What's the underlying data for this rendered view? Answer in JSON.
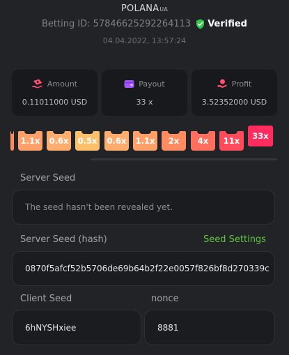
{
  "brand": {
    "name": "POLANA",
    "suffix": "UA"
  },
  "bet": {
    "id_label": "Betting ID:",
    "id_value": "57846625292264113",
    "verified_label": "Verified",
    "datetime": "04.04.2022, 13:57:24"
  },
  "stats": {
    "amount": {
      "label": "Amount",
      "value": "0.11011000 USD",
      "icon": "money-hand-icon"
    },
    "payout": {
      "label": "Payout",
      "value": "33 x",
      "icon": "wallet-icon"
    },
    "profit": {
      "label": "Profit",
      "value": "3.52352000 USD",
      "icon": "coin-hand-icon"
    }
  },
  "multipliers": [
    {
      "label": "",
      "color": "#ff8a5c"
    },
    {
      "label": "1.1x",
      "color": "#ff9f69"
    },
    {
      "label": "0.6x",
      "color": "#ffad6e"
    },
    {
      "label": "0.5x",
      "color": "#ffc06c"
    },
    {
      "label": "0.6x",
      "color": "#ffad6e"
    },
    {
      "label": "1.1x",
      "color": "#ff9f69"
    },
    {
      "label": "2x",
      "color": "#ff8c60"
    },
    {
      "label": "4x",
      "color": "#ff6f5e"
    },
    {
      "label": "11x",
      "color": "#ff4b5b"
    },
    {
      "label": "33x",
      "color": "#ff2d5e"
    }
  ],
  "server_seed": {
    "label": "Server Seed",
    "value": "The seed hasn't been revealed yet."
  },
  "server_hash": {
    "label": "Server Seed (hash)",
    "settings_link": "Seed Settings",
    "value": "0870f5afcf52b5706de69b64b2f22e0057f826bf8d270339c"
  },
  "client_seed": {
    "label": "Client Seed",
    "value": "6hNYSHxiee"
  },
  "nonce": {
    "label": "nonce",
    "value": "8881"
  },
  "colors": {
    "background": "#222327",
    "card": "#18191c",
    "accent_green": "#5fc53d",
    "amount_icon": "#ff4f6e",
    "payout_icon": "#a855f7",
    "profit_icon": "#ff4f6e"
  }
}
